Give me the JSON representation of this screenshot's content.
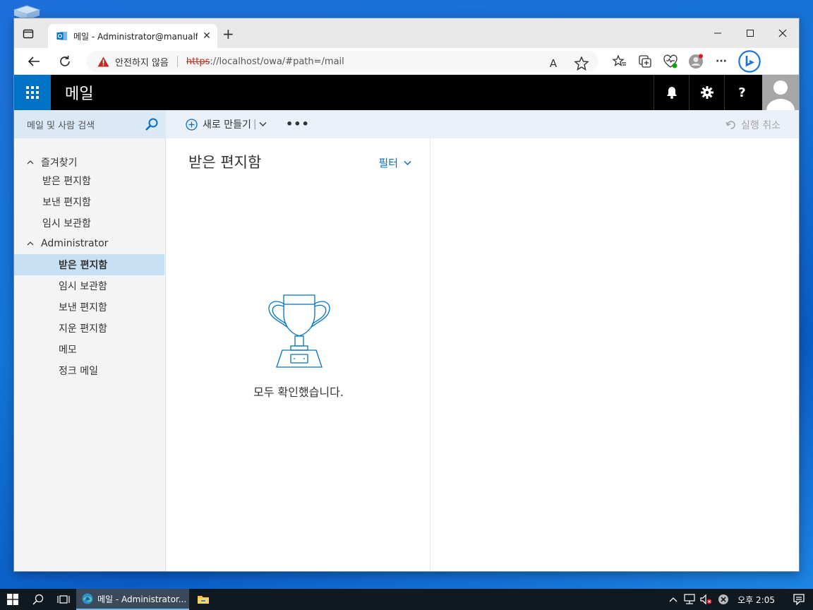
{
  "browser": {
    "tab_title": "메일 - Administrator@manualfac",
    "new_tab_symbol": "+",
    "address": {
      "warning": "안전하지 않음",
      "scheme": "https",
      "rest": "://localhost/owa/#path=/mail"
    },
    "read_aloud": "A",
    "more_symbol": "···"
  },
  "owa": {
    "app_title": "메일",
    "help_symbol": "?",
    "search_placeholder": "메일 및 사람 검색",
    "new_label": "새로 만들기",
    "more_symbol": "•••",
    "undo_label": "실행 취소",
    "favorites": {
      "label": "즐겨찾기",
      "items": [
        "받은 편지함",
        "보낸 편지함",
        "임시 보관함"
      ]
    },
    "account": {
      "label": "Administrator",
      "items": [
        "받은 편지함",
        "임시 보관함",
        "보낸 편지함",
        "지운 편지함",
        "메모",
        "정크 메일"
      ],
      "selected_index": 0
    },
    "list": {
      "title": "받은 편지함",
      "filter_label": "필터",
      "empty_message": "모두 확인했습니다."
    }
  },
  "taskbar": {
    "app_label": "메일 - Administrator...",
    "clock": "오후 2:05"
  },
  "colors": {
    "owa_blue": "#0072c6",
    "owa_header": "#000000",
    "selected_folder": "#c7e0f4",
    "cmdbar": "#eaf1f9",
    "warning_red": "#c42b1c"
  }
}
